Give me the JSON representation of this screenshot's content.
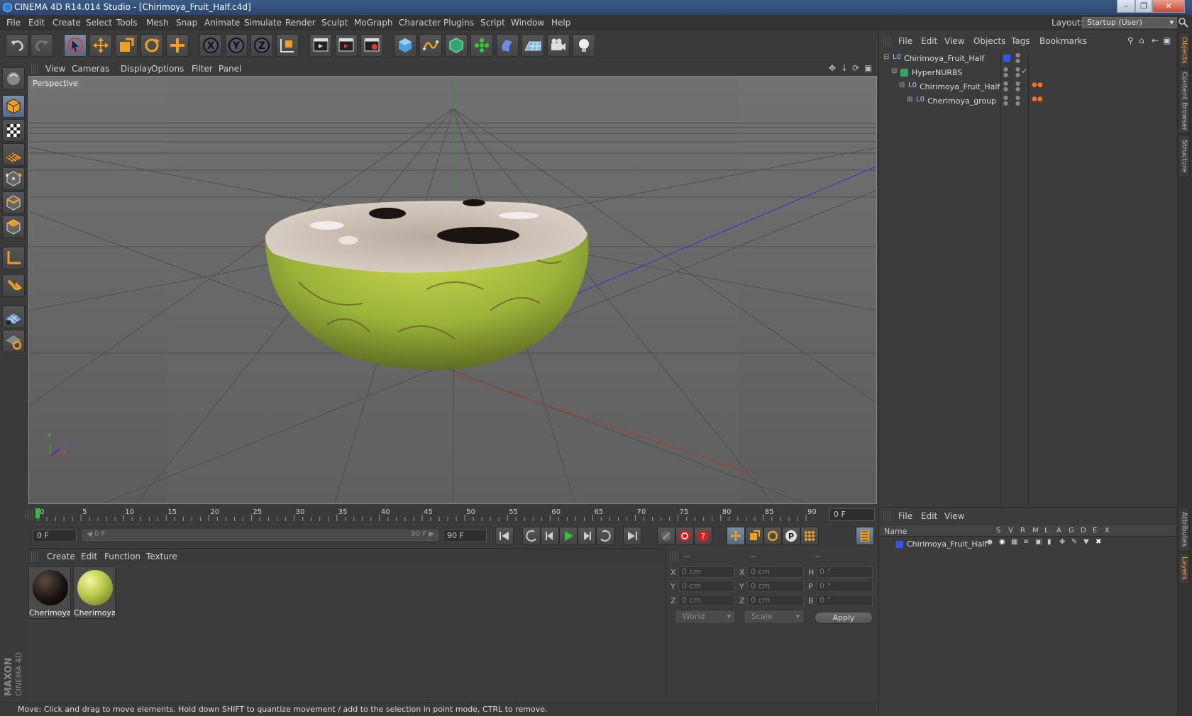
{
  "window": {
    "title": "CINEMA 4D R14.014 Studio - [Chirimoya_Fruit_Half.c4d]",
    "controls": [
      "minimize-icon",
      "restore-icon",
      "close-icon"
    ]
  },
  "menubar": {
    "items": [
      "File",
      "Edit",
      "Create",
      "Select",
      "Tools",
      "Mesh",
      "Snap",
      "Animate",
      "Simulate",
      "Render",
      "Sculpt",
      "MoGraph",
      "Character",
      "Plugins",
      "Script",
      "Window",
      "Help"
    ],
    "layout_label": "Layout:",
    "layout_value": "Startup (User)"
  },
  "toolbar": {
    "icons": [
      "undo-icon",
      "redo-icon",
      "live-selection-icon",
      "move-icon",
      "scale-icon",
      "rotate-icon",
      "create-object-icon",
      "x-axis-icon",
      "y-axis-icon",
      "z-axis-icon",
      "coordinate-system-icon",
      "render-view-icon",
      "render-picture-viewer-icon",
      "edit-render-settings-icon",
      "cube-primitive-icon",
      "spline-icon",
      "nurbs-icon",
      "array-icon",
      "deformer-icon",
      "floor-icon",
      "camera-icon",
      "light-icon"
    ]
  },
  "lefttools": {
    "icons": [
      "make-editable-icon",
      "model-mode-icon",
      "texture-mode-icon",
      "workplane-mode-icon",
      "points-mode-icon",
      "edges-mode-icon",
      "polygons-mode-icon",
      "axis-mode-icon",
      "tweak-mode-icon",
      "snapping-icon",
      "locked-workplane-icon"
    ]
  },
  "viewport": {
    "menu": [
      "View",
      "Cameras",
      "Display",
      "Options",
      "Filter",
      "Panel"
    ],
    "label": "Perspective",
    "axis_labels": {
      "y": "Y",
      "z": "Z",
      "x": "X"
    }
  },
  "timeline": {
    "ticks": [
      "0",
      "5",
      "10",
      "15",
      "20",
      "25",
      "30",
      "35",
      "40",
      "45",
      "50",
      "55",
      "60",
      "65",
      "70",
      "75",
      "80",
      "85",
      "90"
    ],
    "current_frame": "0 F"
  },
  "anim_controls": {
    "start_field": "0 F",
    "range_start": "0 F",
    "range_end": "90 F",
    "end_field": "90 F"
  },
  "materials": {
    "menu": [
      "Create",
      "Edit",
      "Function",
      "Texture"
    ],
    "items": [
      {
        "name": "Cherimoya",
        "color": "#1a1512"
      },
      {
        "name": "Cherimoya",
        "color": "#b8c84a"
      }
    ]
  },
  "coords": {
    "header": [
      "--",
      "--",
      "--"
    ],
    "rows": [
      {
        "a": "X",
        "av": "0 cm",
        "b": "X",
        "bv": "0 cm",
        "c": "H",
        "cv": "0 °"
      },
      {
        "a": "Y",
        "av": "0 cm",
        "b": "Y",
        "bv": "0 cm",
        "c": "P",
        "cv": "0 °"
      },
      {
        "a": "Z",
        "av": "0 cm",
        "b": "Z",
        "bv": "0 cm",
        "c": "B",
        "cv": "0 °"
      }
    ],
    "space": "World",
    "mode": "Scale",
    "apply": "Apply"
  },
  "statusbar": {
    "text": "Move: Click and drag to move elements. Hold down SHIFT to quantize movement / add to the selection in point mode, CTRL to remove."
  },
  "objects": {
    "menu": [
      "File",
      "Edit",
      "View",
      "Objects",
      "Tags",
      "Bookmarks"
    ],
    "rows": [
      {
        "name": "Chirimoya_Fruit_Half",
        "indent": 0
      },
      {
        "name": "HyperNURBS",
        "indent": 1
      },
      {
        "name": "Chirimoya_Fruit_Half",
        "indent": 2
      },
      {
        "name": "Cherimoya_group",
        "indent": 3
      }
    ]
  },
  "layers": {
    "menu": [
      "File",
      "Edit",
      "View"
    ],
    "name_header": "Name",
    "col_headers": [
      "S",
      "V",
      "R",
      "M",
      "L",
      "A",
      "G",
      "D",
      "E",
      "X"
    ],
    "rows": [
      {
        "name": "Chirimoya_Fruit_Half",
        "color": "#3355ff"
      }
    ]
  },
  "side_tabs": [
    "Objects",
    "Content Browser",
    "Structure",
    "Attributes",
    "Layers"
  ],
  "brand": {
    "text": "MAXON CINEMA 4D"
  }
}
